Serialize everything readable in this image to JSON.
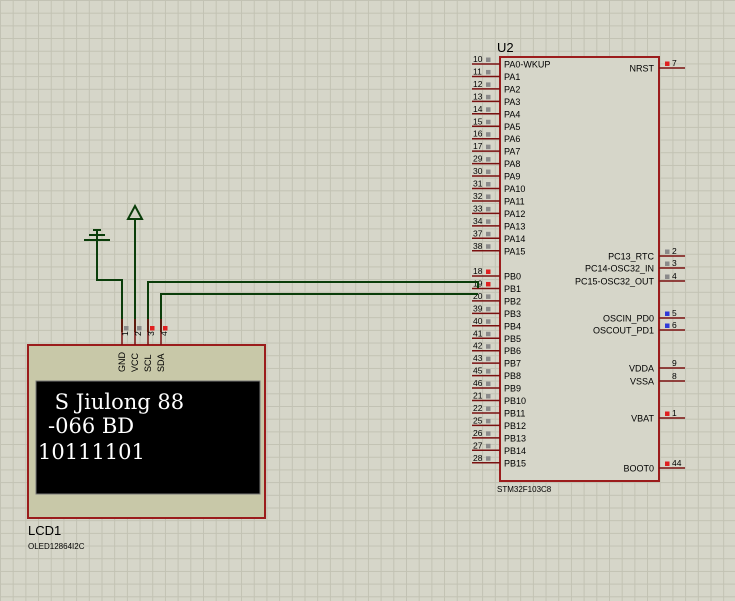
{
  "mcu": {
    "ref": "U2",
    "part": "STM32F103C8",
    "left_pins": [
      {
        "num": "10",
        "name": "PA0-WKUP"
      },
      {
        "num": "11",
        "name": "PA1"
      },
      {
        "num": "12",
        "name": "PA2"
      },
      {
        "num": "13",
        "name": "PA3"
      },
      {
        "num": "14",
        "name": "PA4"
      },
      {
        "num": "15",
        "name": "PA5"
      },
      {
        "num": "16",
        "name": "PA6"
      },
      {
        "num": "17",
        "name": "PA7"
      },
      {
        "num": "29",
        "name": "PA8"
      },
      {
        "num": "30",
        "name": "PA9"
      },
      {
        "num": "31",
        "name": "PA10"
      },
      {
        "num": "32",
        "name": "PA11"
      },
      {
        "num": "33",
        "name": "PA12"
      },
      {
        "num": "34",
        "name": "PA13"
      },
      {
        "num": "37",
        "name": "PA14"
      },
      {
        "num": "38",
        "name": "PA15"
      },
      {
        "num": "18",
        "name": "PB0"
      },
      {
        "num": "19",
        "name": "PB1"
      },
      {
        "num": "20",
        "name": "PB2"
      },
      {
        "num": "39",
        "name": "PB3"
      },
      {
        "num": "40",
        "name": "PB4"
      },
      {
        "num": "41",
        "name": "PB5"
      },
      {
        "num": "42",
        "name": "PB6"
      },
      {
        "num": "43",
        "name": "PB7"
      },
      {
        "num": "45",
        "name": "PB8"
      },
      {
        "num": "46",
        "name": "PB9"
      },
      {
        "num": "21",
        "name": "PB10"
      },
      {
        "num": "22",
        "name": "PB11"
      },
      {
        "num": "25",
        "name": "PB12"
      },
      {
        "num": "26",
        "name": "PB13"
      },
      {
        "num": "27",
        "name": "PB14"
      },
      {
        "num": "28",
        "name": "PB15"
      }
    ],
    "right_pins": [
      {
        "num": "7",
        "name": "NRST"
      },
      {
        "num": "2",
        "name": "PC13_RTC"
      },
      {
        "num": "3",
        "name": "PC14-OSC32_IN"
      },
      {
        "num": "4",
        "name": "PC15-OSC32_OUT"
      },
      {
        "num": "5",
        "name": "OSCIN_PD0"
      },
      {
        "num": "6",
        "name": "OSCOUT_PD1"
      },
      {
        "num": "9",
        "name": "VDDA"
      },
      {
        "num": "8",
        "name": "VSSA"
      },
      {
        "num": "1",
        "name": "VBAT"
      },
      {
        "num": "44",
        "name": "BOOT0"
      }
    ]
  },
  "lcd": {
    "ref": "LCD1",
    "part": "OLED12864I2C",
    "pins": [
      {
        "num": "1",
        "name": "GND"
      },
      {
        "num": "2",
        "name": "VCC"
      },
      {
        "num": "3",
        "name": "SCL"
      },
      {
        "num": "4",
        "name": "SDA"
      }
    ],
    "screen_lines": [
      " S Jiulong 88",
      "-066 BD",
      "10111101"
    ]
  },
  "colors": {
    "body_outline": "#9b1c1c",
    "wire": "#0a3d0a",
    "pin": "#7a1010",
    "grid": "#c2c2b3",
    "screen": "#000000",
    "pin_state_low": "#2f3ad8",
    "pin_state_high": "#e02020",
    "pin_state_float": "#8a8a8a"
  }
}
